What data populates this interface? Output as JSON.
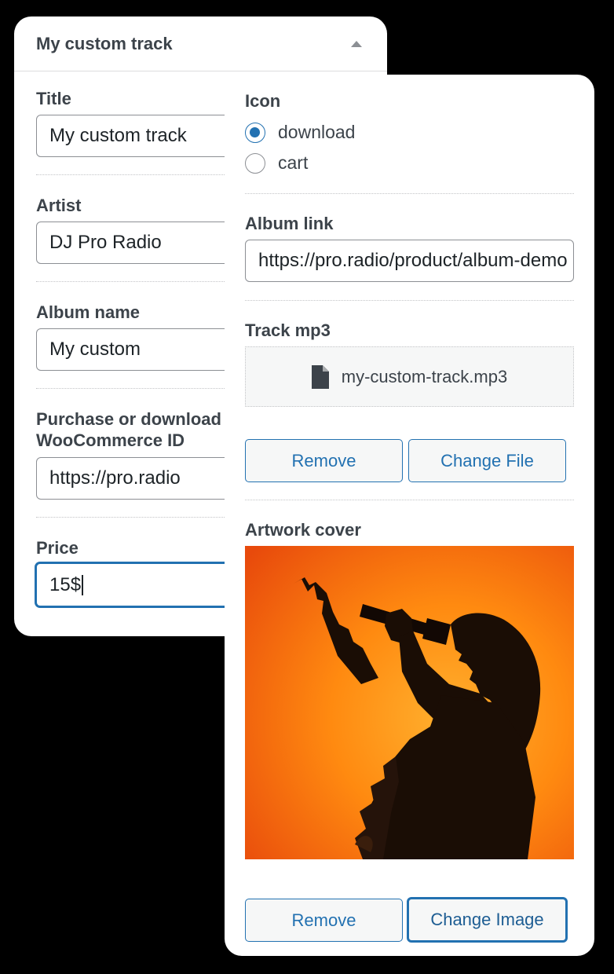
{
  "track_panel": {
    "header_title": "My custom track",
    "title_label": "Title",
    "title_value": "My custom track",
    "artist_label": "Artist",
    "artist_value": "DJ Pro Radio",
    "album_name_label": "Album name",
    "album_name_value": "My custom",
    "purchase_label_line1": "Purchase or download",
    "purchase_label_line2": "WooCommerce ID",
    "purchase_value": "https://pro.radio",
    "price_label": "Price",
    "price_value": "15$"
  },
  "details_panel": {
    "icon_label": "Icon",
    "icon_options": [
      {
        "label": "download",
        "checked": true
      },
      {
        "label": "cart",
        "checked": false
      }
    ],
    "album_link_label": "Album link",
    "album_link_value": "https://pro.radio/product/album-demo",
    "track_mp3_label": "Track mp3",
    "track_file_name": "my-custom-track.mp3",
    "file_icon": "document-icon",
    "track_remove_label": "Remove",
    "track_change_label": "Change File",
    "artwork_label": "Artwork cover",
    "artwork_remove_label": "Remove",
    "artwork_change_label": "Change Image"
  },
  "colors": {
    "accent": "#2271b1",
    "backdrop": "#000000",
    "artwork_orange": "#ff9a1e"
  }
}
